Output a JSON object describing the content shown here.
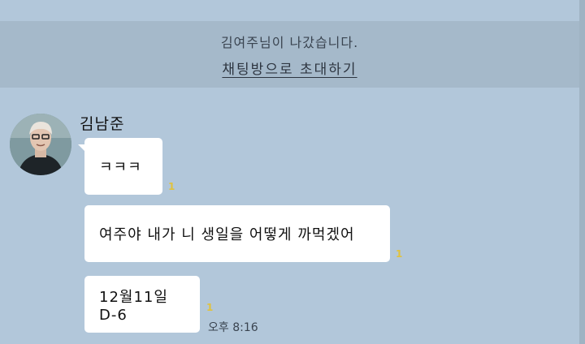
{
  "system": {
    "left_message": "김여주님이 나갔습니다.",
    "invite_link": "채팅방으로 초대하기"
  },
  "chat": {
    "sender_name": "김남준",
    "messages": [
      {
        "text": "ㅋㅋㅋ",
        "unread": "1"
      },
      {
        "text": "여주야 내가 니 생일을 어떻게 까먹겠어",
        "unread": "1"
      },
      {
        "text": "12월11일 D-6",
        "unread": "1"
      }
    ],
    "time": "오후 8:16"
  },
  "colors": {
    "background": "#b2c7da",
    "banner": "#a5b9ca",
    "bubble": "#ffffff",
    "unread": "#e0c23e"
  }
}
